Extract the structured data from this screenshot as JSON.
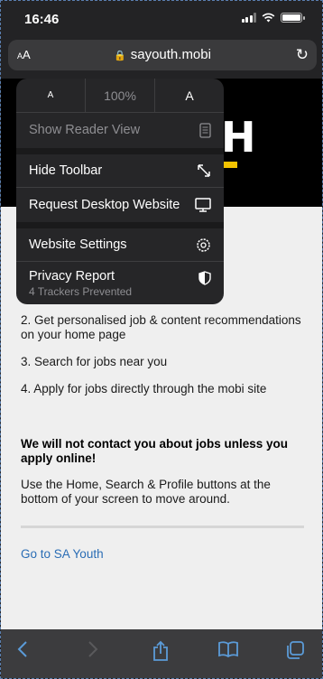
{
  "status_bar": {
    "time": "16:46"
  },
  "address_bar": {
    "aa_small": "A",
    "aa_large": "A",
    "url": "sayouth.mobi"
  },
  "hero": {
    "logo_fragment": "H"
  },
  "menu": {
    "zoom_decrease": "A",
    "zoom_level": "100%",
    "zoom_increase": "A",
    "items": [
      {
        "label": "Show Reader View",
        "disabled": true
      },
      {
        "label": "Hide Toolbar"
      },
      {
        "label": "Request Desktop Website"
      },
      {
        "label": "Website Settings"
      },
      {
        "label": "Privacy Report",
        "sublabel": "4 Trackers Prevented"
      }
    ]
  },
  "content": {
    "steps": [
      "2. Get personalised job & content recommendations on your home page",
      "3. Search for jobs near you",
      "4. Apply for jobs directly through the mobi site"
    ],
    "notice": "We will not contact you about jobs unless you apply online!",
    "help": "Use the Home, Search & Profile buttons at the bottom of your screen to move around.",
    "link": "Go to SA Youth"
  },
  "colors": {
    "link": "#2a6db5",
    "accent": "#f4c300",
    "toolbar_icon": "#5b9bd8"
  }
}
